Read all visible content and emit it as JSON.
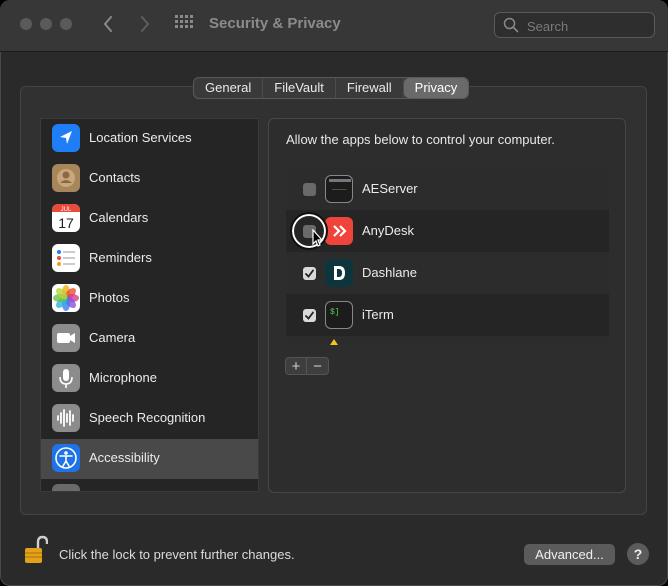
{
  "window": {
    "title": "Security & Privacy"
  },
  "search": {
    "placeholder": "Search",
    "value": ""
  },
  "tabs": [
    {
      "label": "General",
      "active": false
    },
    {
      "label": "FileVault",
      "active": false
    },
    {
      "label": "Firewall",
      "active": false
    },
    {
      "label": "Privacy",
      "active": true
    }
  ],
  "sidebar": {
    "items": [
      {
        "label": "Location Services",
        "icon": "location-arrow-icon",
        "color": "#1f7ef5"
      },
      {
        "label": "Contacts",
        "icon": "contacts-icon",
        "color": "#a8865c"
      },
      {
        "label": "Calendars",
        "icon": "calendar-icon",
        "color": "#ffffff",
        "month": "JUL",
        "day": "17"
      },
      {
        "label": "Reminders",
        "icon": "reminders-icon",
        "color": "#ffffff"
      },
      {
        "label": "Photos",
        "icon": "photos-icon",
        "color": "#ffffff"
      },
      {
        "label": "Camera",
        "icon": "camera-icon",
        "color": "#8d8c8d"
      },
      {
        "label": "Microphone",
        "icon": "microphone-icon",
        "color": "#8d8c8d"
      },
      {
        "label": "Speech Recognition",
        "icon": "waveform-icon",
        "color": "#8d8c8d"
      },
      {
        "label": "Accessibility",
        "icon": "accessibility-icon",
        "color": "#1e73e8",
        "selected": true
      }
    ]
  },
  "accessibility": {
    "heading": "Allow the apps below to control your computer.",
    "apps": [
      {
        "name": "AEServer",
        "checked": false,
        "icon": "terminal-icon"
      },
      {
        "name": "AnyDesk",
        "checked": false,
        "icon": "anydesk-icon"
      },
      {
        "name": "Dashlane",
        "checked": true,
        "icon": "dashlane-icon"
      },
      {
        "name": "iTerm",
        "checked": true,
        "icon": "iterm-icon"
      }
    ],
    "add_label": "+",
    "remove_label": "−"
  },
  "footer": {
    "lock_text": "Click the lock to prevent further changes.",
    "advanced_label": "Advanced...",
    "help_label": "?"
  },
  "colors": {
    "accent": "#1e73e8",
    "lock": "#e3a21a",
    "anydesk": "#ef443b",
    "dashlane": "#0e353d"
  }
}
